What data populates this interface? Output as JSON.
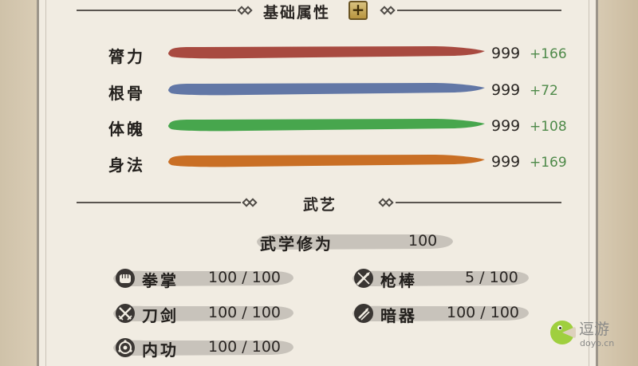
{
  "header": {
    "title": "基础属性",
    "plus_label": "+"
  },
  "stats": [
    {
      "label": "膂力",
      "value": "999",
      "bonus": "+166",
      "color": "#a84a40"
    },
    {
      "label": "根骨",
      "value": "999",
      "bonus": "+72",
      "color": "#6277a6"
    },
    {
      "label": "体魄",
      "value": "999",
      "bonus": "+108",
      "color": "#47a64d"
    },
    {
      "label": "身法",
      "value": "999",
      "bonus": "+169",
      "color": "#c96f25"
    }
  ],
  "martial": {
    "title": "武艺",
    "mastery_label": "武学修为",
    "mastery_value": "100",
    "skills": [
      {
        "label": "拳掌",
        "value": "100 / 100",
        "icon": "fist-icon"
      },
      {
        "label": "刀剑",
        "value": "100 / 100",
        "icon": "crossed-swords-icon"
      },
      {
        "label": "内功",
        "value": "100 / 100",
        "icon": "energy-swirl-icon"
      },
      {
        "label": "枪棒",
        "value": "5 / 100",
        "icon": "spear-staff-icon"
      },
      {
        "label": "暗器",
        "value": "100 / 100",
        "icon": "hidden-weapon-icon"
      }
    ]
  },
  "watermark": {
    "name": "逗游",
    "url": "doyo.cn"
  }
}
